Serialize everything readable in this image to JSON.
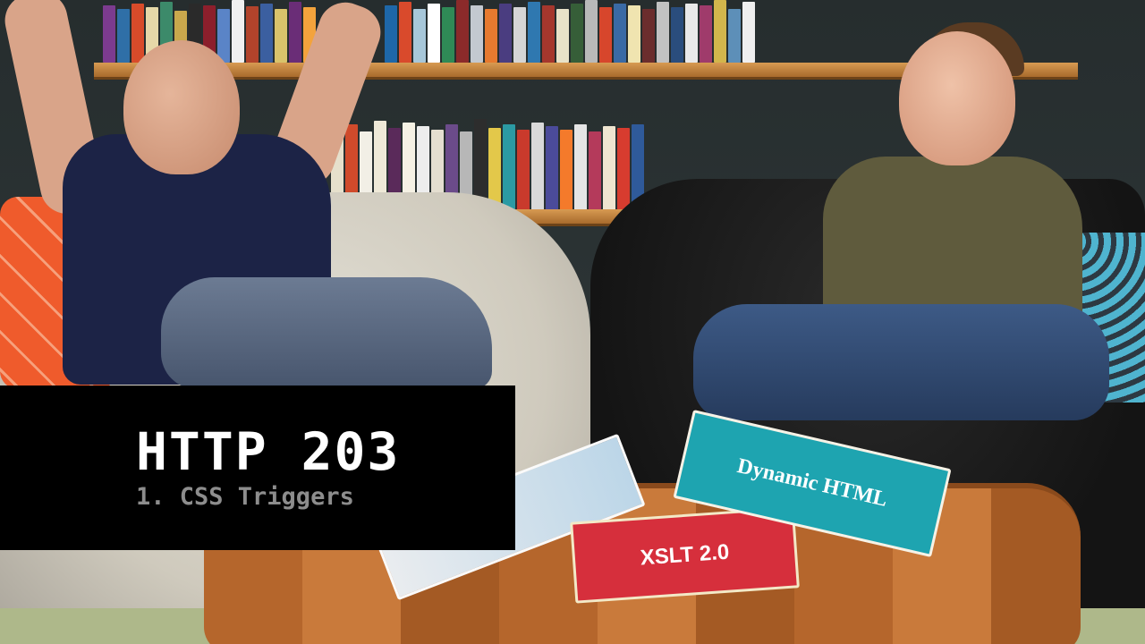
{
  "lower_third": {
    "title": "HTTP 203",
    "subtitle": "1. CSS Triggers"
  },
  "props": {
    "book_red_label": "XSLT 2.0",
    "book_teal_label": "Dynamic HTML"
  },
  "colors": {
    "lower_third_bg": "#000000",
    "title_text": "#ffffff",
    "subtitle_text": "#8d8d8d"
  }
}
